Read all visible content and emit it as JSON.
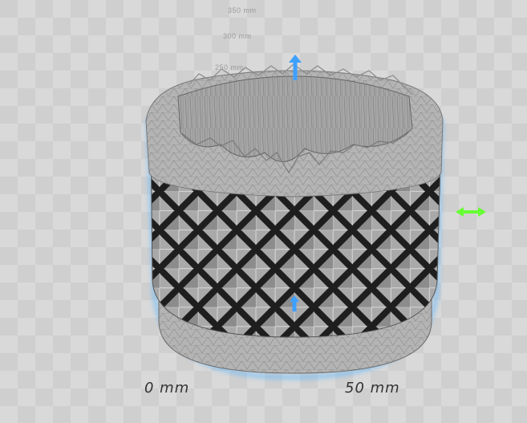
{
  "viewport": {
    "height_markers": [
      "350 mm",
      "300 mm",
      "250 mm"
    ],
    "ruler_labels": [
      "0 mm",
      "50 mm"
    ],
    "model": {
      "name": "knurled cylindrical cup",
      "mesh_color": "#b8b8b8",
      "outline_color": "#5fb8ff"
    },
    "gizmo": {
      "vertical_axis_color": "#3ea0ff",
      "horizontal_axis_color": "#66ff33"
    }
  }
}
